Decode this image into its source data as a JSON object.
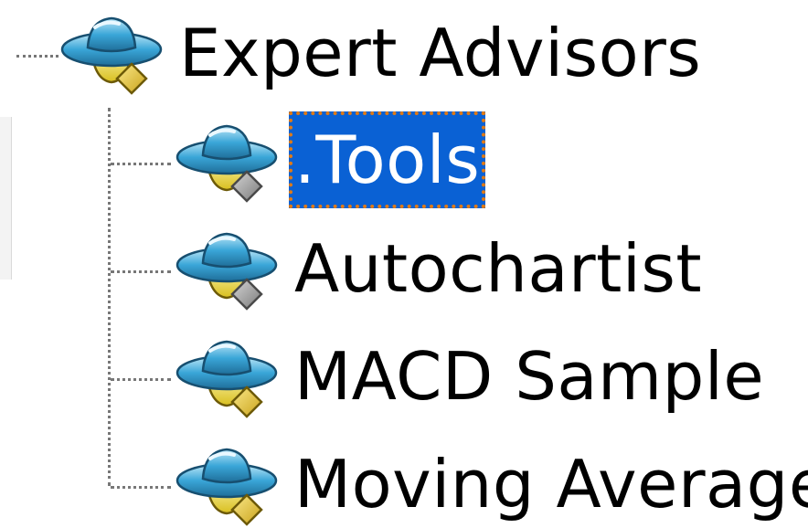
{
  "tree": {
    "root": {
      "label": "Expert Advisors",
      "icon": "expert-advisor-hat-icon"
    },
    "children": [
      {
        "label": ".Tools",
        "icon": "expert-advisor-hat-icon",
        "badge_color": "#8c8c8c",
        "selected": true
      },
      {
        "label": "Autochartist",
        "icon": "expert-advisor-hat-icon",
        "badge_color": "#8c8c8c",
        "selected": false
      },
      {
        "label": "MACD Sample",
        "icon": "expert-advisor-hat-icon",
        "badge_color": "#e8c23a",
        "selected": false
      },
      {
        "label": "Moving Average",
        "icon": "expert-advisor-hat-icon",
        "badge_color": "#e8c23a",
        "selected": false
      }
    ]
  },
  "colors": {
    "selection": "#0a61d4",
    "selection_border": "#e07a16",
    "hat": "#3aa6d8",
    "face": "#f2e24a"
  }
}
